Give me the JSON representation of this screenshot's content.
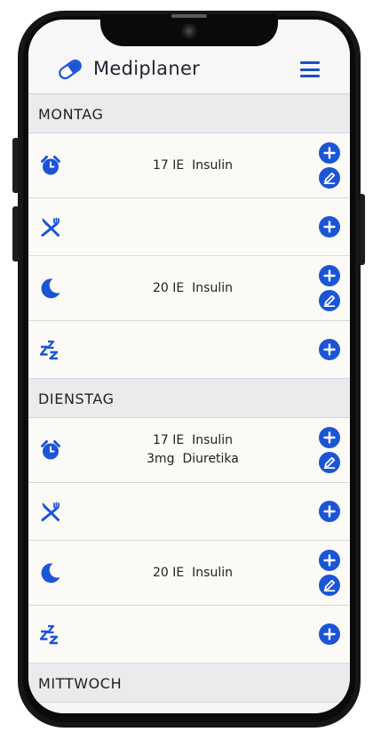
{
  "app": {
    "title": "Mediplaner"
  },
  "icons": {
    "logo": "pill-icon",
    "menu": "hamburger-menu-icon",
    "morning": "alarm-clock-icon",
    "lunch": "fork-knife-icon",
    "evening": "moon-icon",
    "night": "sleep-zzz-icon",
    "add": "plus-circle-icon",
    "edit": "pencil-circle-icon"
  },
  "colors": {
    "accent": "#1b55d6",
    "header_bg": "#eaebed",
    "row_bg": "#fbfaf6"
  },
  "days": [
    {
      "label": "MONTAG",
      "slots": [
        {
          "icon": "alarm-clock-icon",
          "meds": [
            {
              "amount": "17 IE",
              "name": "Insulin"
            }
          ],
          "editable": true
        },
        {
          "icon": "fork-knife-icon",
          "meds": [],
          "editable": false
        },
        {
          "icon": "moon-icon",
          "meds": [
            {
              "amount": "20 IE",
              "name": "Insulin"
            }
          ],
          "editable": true
        },
        {
          "icon": "sleep-zzz-icon",
          "meds": [],
          "editable": false
        }
      ]
    },
    {
      "label": "DIENSTAG",
      "slots": [
        {
          "icon": "alarm-clock-icon",
          "meds": [
            {
              "amount": "17 IE",
              "name": "Insulin"
            },
            {
              "amount": "3mg",
              "name": "Diuretika"
            }
          ],
          "editable": true
        },
        {
          "icon": "fork-knife-icon",
          "meds": [],
          "editable": false
        },
        {
          "icon": "moon-icon",
          "meds": [
            {
              "amount": "20 IE",
              "name": "Insulin"
            }
          ],
          "editable": true
        },
        {
          "icon": "sleep-zzz-icon",
          "meds": [],
          "editable": false
        }
      ]
    },
    {
      "label": "MITTWOCH",
      "slots": []
    }
  ]
}
